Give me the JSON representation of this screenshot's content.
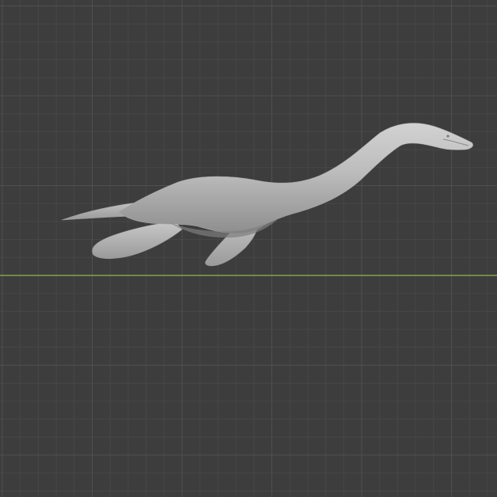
{
  "viewport": {
    "background_color": "#3d3d3d",
    "grid": true,
    "grid_minor_color": "#474747",
    "grid_major_color": "#505050",
    "x_axis_color": "#7fa44a",
    "object": {
      "icon": "plesiosaur-mesh",
      "color": "#b8b8b8",
      "shade_color": "#8f8f8f",
      "highlight_color": "#d4d4d4"
    }
  }
}
